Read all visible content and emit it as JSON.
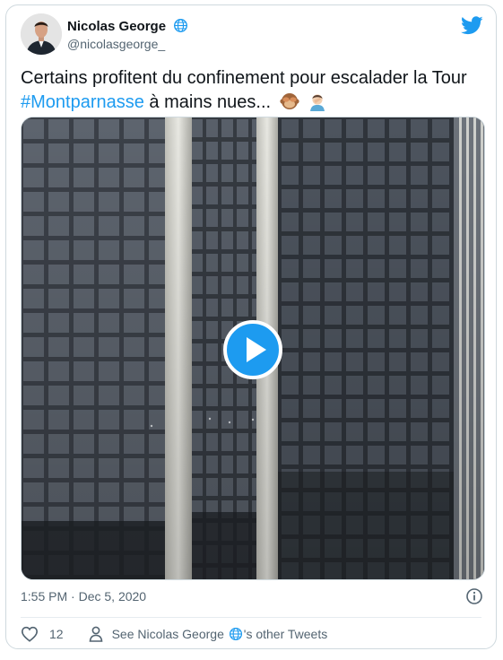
{
  "author": {
    "name": "Nicolas George",
    "handle": "@nicolasgeorge_",
    "avatar_icon": "profile-photo"
  },
  "brand": {
    "logo_icon": "twitter-bird-icon",
    "accent": "#1d9bf0"
  },
  "tweet": {
    "text_before": "Certains profitent du confinement pour escalader la Tour",
    "hashtag": "#Montparnasse",
    "text_after": " à mains nues...",
    "emojis": [
      "see-no-evil-monkey-icon",
      "man-facepalming-icon"
    ]
  },
  "media": {
    "type": "video",
    "play_icon": "play-icon"
  },
  "meta": {
    "time": "1:55 PM",
    "separator": " · ",
    "date": "Dec 5, 2020",
    "info_icon": "info-icon"
  },
  "actions": {
    "like_count": "12",
    "other_prefix": "See Nicolas George ",
    "other_suffix": "'s other Tweets"
  }
}
